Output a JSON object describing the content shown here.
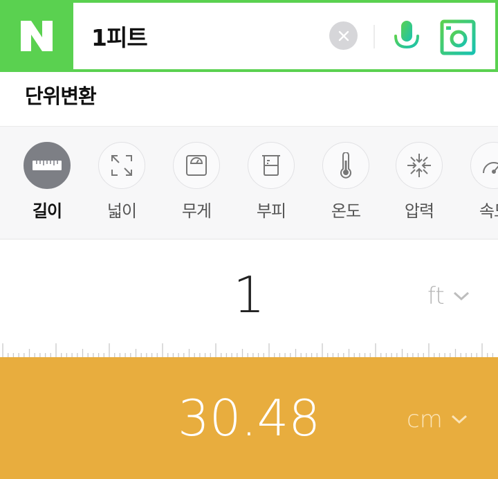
{
  "search": {
    "logo_letter": "N",
    "query": "1피트"
  },
  "section": {
    "title": "단위변환"
  },
  "categories": [
    {
      "label": "길이",
      "icon": "ruler-icon",
      "active": true
    },
    {
      "label": "넓이",
      "icon": "expand-arrows-icon",
      "active": false
    },
    {
      "label": "무게",
      "icon": "scale-icon",
      "active": false
    },
    {
      "label": "부피",
      "icon": "beaker-icon",
      "active": false
    },
    {
      "label": "온도",
      "icon": "thermometer-icon",
      "active": false
    },
    {
      "label": "압력",
      "icon": "compress-arrows-icon",
      "active": false
    },
    {
      "label": "속도",
      "icon": "speedometer-icon",
      "active": false
    }
  ],
  "converter": {
    "input_value": "1",
    "input_unit": "ft",
    "result_value": "30.48",
    "result_unit": "cm"
  },
  "colors": {
    "brand_green": "#5ad150",
    "accent_teal": "#2ec8a6",
    "result_band": "#e8ad3e"
  }
}
